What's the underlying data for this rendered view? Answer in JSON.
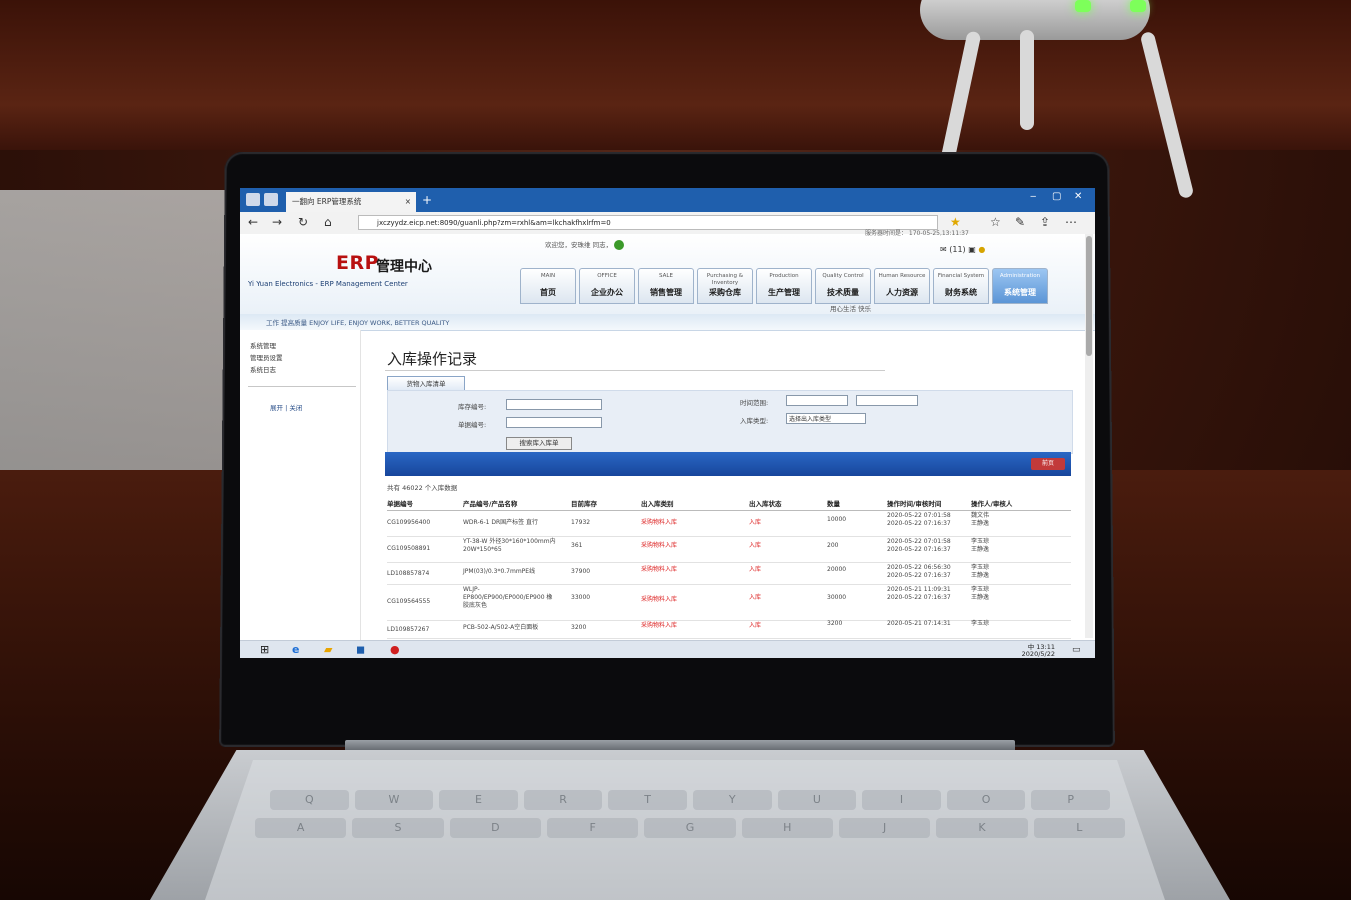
{
  "browser": {
    "tab_title": "一翻向 ERP管理系统",
    "url": "jxczyydz.eicp.net:8090/guanli.php?zm=rxhl&am=lkchakfhxlrfm=0",
    "new_tab_symbol": "+",
    "tab_close_symbol": "×"
  },
  "header": {
    "logo_erp": "ERP",
    "logo_cn": "管理中心",
    "company": "Yi Yuan Electronics - ERP Management Center",
    "greeting": "欢迎您，安珠维 同志，",
    "clock": "服务器时间是：  170-05-25,13:11:37",
    "icons_text": "(11)"
  },
  "menus": [
    {
      "en": "MAIN",
      "cn": "首页"
    },
    {
      "en": "OFFICE",
      "cn": "企业办公"
    },
    {
      "en": "SALE",
      "cn": "销售管理"
    },
    {
      "en": "Purchasing & Inventory",
      "cn": "采购仓库"
    },
    {
      "en": "Production",
      "cn": "生产管理"
    },
    {
      "en": "Quality Control",
      "cn": "技术质量"
    },
    {
      "en": "Human Resource",
      "cn": "人力资源"
    },
    {
      "en": "Financial System",
      "cn": "财务系统"
    },
    {
      "en": "Administration",
      "cn": "系统管理"
    }
  ],
  "motto": "工作 提高质量 ENJOY LIFE, ENJOY WORK, BETTER QUALITY",
  "slogan": "用心生活 快乐",
  "sidebar": {
    "root": "系统管理",
    "item1": "管理员设置",
    "item2": "系统日志",
    "expand_all": "展开",
    "collapse_all": "关闭"
  },
  "page": {
    "title": "入库操作记录",
    "type_button": "货物入库清单",
    "labels": {
      "warehouse_no": "库存编号:",
      "doc_no": "单据编号:",
      "time_range": "时间范围:",
      "in_type": "入库类型:"
    },
    "type_select": "选择出入库类型",
    "search_button": "搜索库入库单",
    "prev_button": "前页",
    "count_text": "共有 46022 个入库数据"
  },
  "table": {
    "headers": [
      "单据编号",
      "产品编号/产品名称",
      "目前库存",
      "出入库类别",
      "出入库状态",
      "数量",
      "操作时间/审核时间",
      "操作人/审核人"
    ],
    "rows": [
      {
        "doc": "CG109956400",
        "product": "WDR-6-1 DR国产标签 直行",
        "stock": "17932",
        "category": "采购物料入库",
        "status": "入库",
        "qty": "10000",
        "time": "2020-05-22 07:01:58\n2020-05-22 07:16:37",
        "user": "魏文伟\n王静逸"
      },
      {
        "doc": "CG109508891",
        "product": "YT-38-W 外径30*160*100mm内\n20W*150*65",
        "stock": "361",
        "category": "采购物料入库",
        "status": "入库",
        "qty": "200",
        "time": "2020-05-22 07:01:58\n2020-05-22 07:16:37",
        "user": "李玉琼\n王静逸"
      },
      {
        "doc": "LD108857874",
        "product": "JPM(03)/0.3*0.7mmPE线",
        "stock": "37900",
        "category": "采购物料入库",
        "status": "入库",
        "qty": "20000",
        "time": "2020-05-22 06:56:30\n2020-05-22 07:16:37",
        "user": "李玉琼\n王静逸"
      },
      {
        "doc": "CG109564555",
        "product": "WLJP-\nEP800/EP900/EP000/EP900 橡\n胶底灰色",
        "stock": "33000",
        "category": "采购物料入库",
        "status": "入库",
        "qty": "30000",
        "time": "2020-05-21 11:09:31\n2020-05-22 07:16:37",
        "user": "李玉琼\n王静逸"
      },
      {
        "doc": "LD109857267",
        "product": "PCB-502-A/502-A空白面板",
        "stock": "3200",
        "category": "采购物料入库",
        "status": "入库",
        "qty": "3200",
        "time": "2020-05-21 07:14:31",
        "user": "李玉琼"
      }
    ]
  },
  "taskbar": {
    "time": "13:11",
    "date": "2020/5/22",
    "ime": "中"
  },
  "colors": {
    "tabbar": "#1f5fad",
    "accent_red": "#b81010",
    "blue_bar": "#17469c"
  }
}
